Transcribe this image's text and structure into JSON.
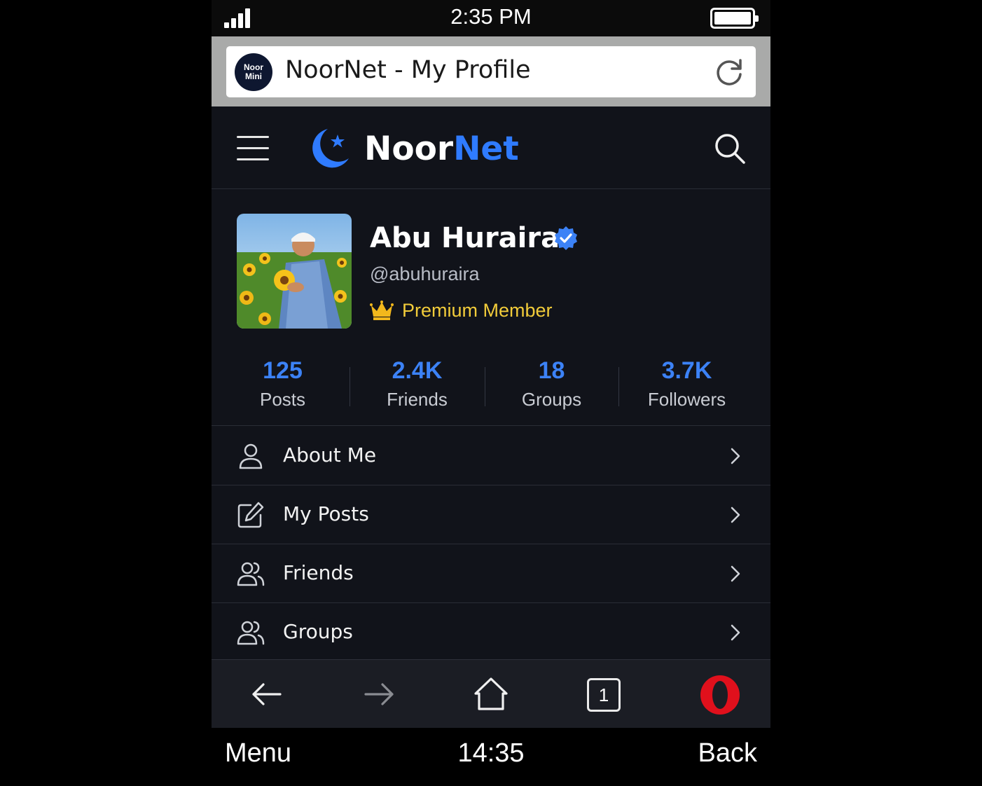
{
  "status_bar": {
    "time": "2:35 PM"
  },
  "browser": {
    "favicon_text": "Noor Mini",
    "tab_title": "NoorNet - My Profile"
  },
  "site": {
    "logo_part1": "Noor",
    "logo_part2": "Net",
    "brand_color": "#2f7bff"
  },
  "profile": {
    "name": "Abu Huraira",
    "handle": "@abuhuraira",
    "badge": "Premium Member",
    "verified": true
  },
  "stats": [
    {
      "value": "125",
      "label": "Posts"
    },
    {
      "value": "2.4K",
      "label": "Friends"
    },
    {
      "value": "18",
      "label": "Groups"
    },
    {
      "value": "3.7K",
      "label": "Followers"
    }
  ],
  "menu": [
    {
      "label": "About Me",
      "icon": "user-icon"
    },
    {
      "label": "My Posts",
      "icon": "edit-icon"
    },
    {
      "label": "Friends",
      "icon": "users-icon"
    },
    {
      "label": "Groups",
      "icon": "users-icon"
    }
  ],
  "toolbar": {
    "tab_count": "1"
  },
  "softkeys": {
    "left": "Menu",
    "center": "14:35",
    "right": "Back"
  },
  "colors": {
    "accent": "#3c82f6",
    "premium": "#f2cc3a",
    "background": "#11131a",
    "opera_red": "#e0101c"
  }
}
